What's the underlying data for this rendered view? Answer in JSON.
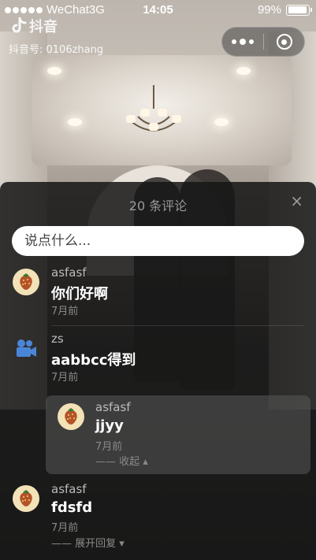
{
  "status_bar": {
    "carrier": "WeChat3G",
    "time": "14:05",
    "battery": "99%"
  },
  "watermark": {
    "app_name": "抖音",
    "account_id": "抖音号: 0106zhang"
  },
  "sheet": {
    "title": "20 条评论",
    "close_label": "×",
    "input_placeholder": "说点什么..."
  },
  "comments": [
    {
      "user": "asfasf",
      "text": "你们好啊",
      "time": "7月前",
      "avatar": "strawberry-avatar-icon"
    },
    {
      "user": "zs",
      "text": "aabbcc得到",
      "time": "7月前",
      "avatar": "video-camera-icon"
    },
    {
      "user": "asfasf",
      "text": "fdsfd",
      "time": "7月前",
      "avatar": "strawberry-avatar-icon",
      "toggle": "—— 展开回复 ▾"
    }
  ],
  "reply": {
    "user": "asfasf",
    "text": "jjyy",
    "time": "7月前",
    "toggle": "—— 收起 ▴",
    "avatar": "strawberry-avatar-icon"
  }
}
